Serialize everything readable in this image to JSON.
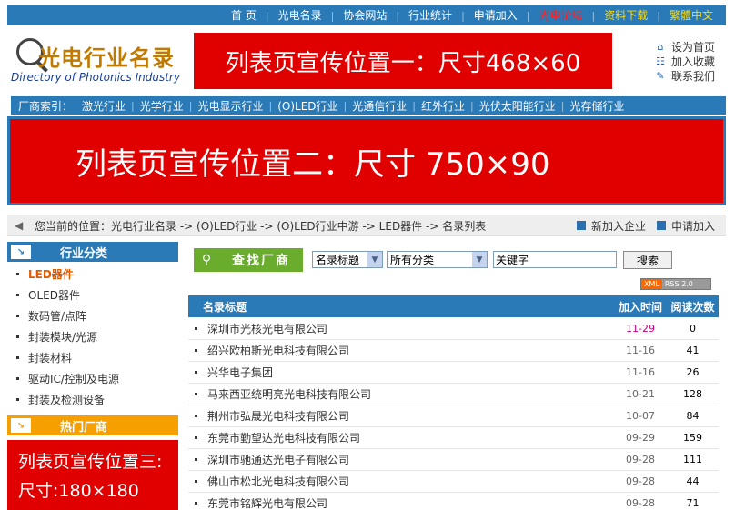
{
  "topnav": [
    "首 页",
    "光电名录",
    "协会网站",
    "行业统计",
    "申请加入",
    "光电论坛",
    "资料下载",
    "繁體中文"
  ],
  "topnav_colors": {
    "normal": "#ffffff",
    "forum": "#ff2020",
    "accent": "#ffd800"
  },
  "logo": {
    "title": "光电行业名录",
    "subtitle": "Directory of Photonics Industry"
  },
  "banner1": "列表页宣传位置一：尺寸468×60",
  "quicklinks": [
    {
      "icon": "home-icon",
      "label": "设为首页"
    },
    {
      "icon": "favorites-icon",
      "label": "加入收藏"
    },
    {
      "icon": "contact-icon",
      "label": "联系我们"
    }
  ],
  "index": {
    "label": "厂商索引：",
    "categories": [
      "激光行业",
      "光学行业",
      "光电显示行业",
      "(O)LED行业",
      "光通信行业",
      "红外行业",
      "光伏太阳能行业",
      "光存储行业"
    ]
  },
  "banner2": "列表页宣传位置二：尺寸 750×90",
  "breadcrumb": {
    "text": "您当前的位置：光电行业名录 -> (O)LED行业 -> (O)LED行业中游 -> LED器件 -> 名录列表",
    "links": [
      "新加入企业",
      "申请加入"
    ]
  },
  "sidebar": {
    "category_heading": "行业分类",
    "items": [
      "LED器件",
      "OLED器件",
      "数码管/点阵",
      "封装模块/光源",
      "封装材料",
      "驱动IC/控制及电源",
      "封装及检测设备"
    ],
    "active_index": 0,
    "hot_heading": "热门厂商",
    "banner3_line1": "列表页宣传位置三:",
    "banner3_line2": "尺寸:180×180"
  },
  "search": {
    "button": "查找厂商",
    "field_select": "名录标题",
    "category_select": "所有分类",
    "keyword": "关键字",
    "submit": "搜索",
    "rss_xml": "XML",
    "rss_label": "RSS 2.0"
  },
  "table": {
    "headers": [
      "名录标题",
      "加入时间",
      "阅读次数"
    ],
    "rows": [
      {
        "name": "深圳市光核光电有限公司",
        "date": "11-29",
        "reads": "0",
        "highlight": true
      },
      {
        "name": "绍兴欧柏斯光电科技有限公司",
        "date": "11-16",
        "reads": "41"
      },
      {
        "name": "兴华电子集团",
        "date": "11-16",
        "reads": "26"
      },
      {
        "name": "马来西亚统明亮光电科技有限公司",
        "date": "10-21",
        "reads": "128"
      },
      {
        "name": "荆州市弘晟光电科技有限公司",
        "date": "10-07",
        "reads": "84"
      },
      {
        "name": "东莞市勤望达光电科技有限公司",
        "date": "09-29",
        "reads": "159"
      },
      {
        "name": "深圳市驰通达光电子有限公司",
        "date": "09-28",
        "reads": "111"
      },
      {
        "name": "佛山市松北光电科技有限公司",
        "date": "09-28",
        "reads": "44"
      },
      {
        "name": "东莞市铭辉光电有限公司",
        "date": "09-28",
        "reads": "71"
      }
    ]
  }
}
